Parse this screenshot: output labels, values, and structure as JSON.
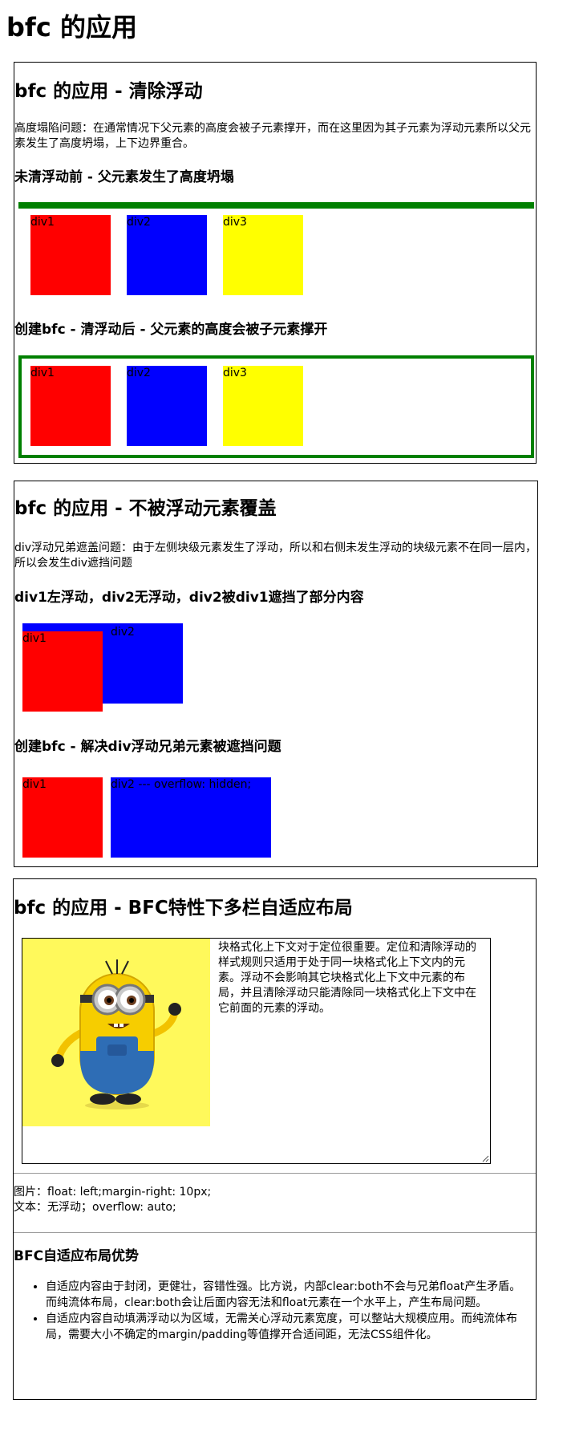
{
  "page_title": "bfc 的应用",
  "section1": {
    "title": "bfc 的应用 - 清除浮动",
    "description": "高度塌陷问题：在通常情况下父元素的高度会被子元素撑开，而在这里因为其子元素为浮动元素所以父元素发生了高度坍塌，上下边界重合。",
    "sub1_title": "未清浮动前 - 父元素发生了高度坍塌",
    "sub2_title": "创建bfc - 清浮动后 - 父元素的高度会被子元素撑开",
    "boxes": [
      "div1",
      "div2",
      "div3"
    ],
    "green": "#008000"
  },
  "section2": {
    "title": "bfc 的应用 - 不被浮动元素覆盖",
    "description": "div浮动兄弟遮盖问题：由于左侧块级元素发生了浮动，所以和右侧未发生浮动的块级元素不在同一层内，所以会发生div遮挡问题",
    "sub1_title": "div1左浮动，div2无浮动，div2被div1遮挡了部分内容",
    "sub2_title": "创建bfc - 解决div浮动兄弟元素被遮挡问题",
    "box1": "div1",
    "box2": "div2",
    "box2_fixed": "div2 --- overflow: hidden;"
  },
  "section3": {
    "title": "bfc 的应用 - BFC特性下多栏自适应布局",
    "image_bg": "#fff95b",
    "image_alt": "minion",
    "text": "块格式化上下文对于定位很重要。定位和清除浮动的样式规则只适用于处于同一块格式化上下文内的元素。浮动不会影响其它块格式化上下文中元素的布局，并且清除浮动只能清除同一块格式化上下文中在它前面的元素的浮动。",
    "note_line1": "图片：float: left;margin-right: 10px;",
    "note_line2": "文本：无浮动；overflow: auto;",
    "adv_title": "BFC自适应布局优势",
    "adv_items": [
      "自适应内容由于封闭，更健壮，容错性强。比方说，内部clear:both不会与兄弟float产生矛盾。而纯流体布局，clear:both会让后面内容无法和float元素在一个水平上，产生布局问题。",
      "自适应内容自动填满浮动以为区域，无需关心浮动元素宽度，可以整站大规模应用。而纯流体布局，需要大小不确定的margin/padding等值撑开合适间距，无法CSS组件化。"
    ]
  }
}
